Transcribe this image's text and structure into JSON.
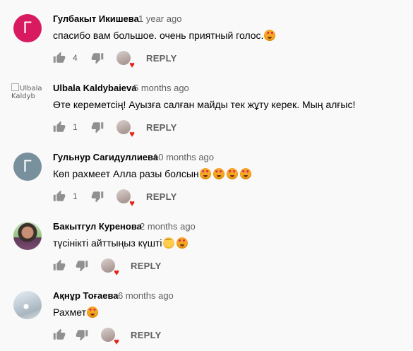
{
  "comments": [
    {
      "author": "Гулбакыт Икишева",
      "time": "1 year ago",
      "text": "спасибо вам большое. очень приятный голос.",
      "emojis": [
        "heart-eyes"
      ],
      "likes": "4",
      "avatar_letter": "Г",
      "reply_label": "REPLY"
    },
    {
      "author": "Ulbala Kaldybaieva",
      "time": "5 months ago",
      "text": "Өте кереметсің! Ауызға салған майды тек жұту керек. Мың алғыс!",
      "emojis": [],
      "likes": "1",
      "avatar_alt": "Ulbala Kaldyb",
      "reply_label": "REPLY"
    },
    {
      "author": "Гульнур Сагидуллиева",
      "time": "10 months ago",
      "text": "Көп рахмеет Алла разы болсын",
      "emojis": [
        "heart-eyes",
        "heart-eyes",
        "heart-eyes",
        "heart-eyes"
      ],
      "likes": "1",
      "avatar_letter": "Г",
      "reply_label": "REPLY"
    },
    {
      "author": "Бакытгул Куренова",
      "time": "2 months ago",
      "text": "түсінікті айттыңыз күшті",
      "emojis": [
        "smiling-face",
        "heart-eyes"
      ],
      "likes": "",
      "reply_label": "REPLY"
    },
    {
      "author": "Ақнұр Тоғаева",
      "time": "6 months ago",
      "text": "Рахмет",
      "emojis": [
        "heart-eyes"
      ],
      "likes": "",
      "reply_label": "REPLY"
    }
  ],
  "colors": {
    "background": "#f9f9f9",
    "avatar_red": "#d81b60",
    "avatar_grey": "#78909c",
    "heart": "#e62117",
    "meta": "#606060"
  }
}
